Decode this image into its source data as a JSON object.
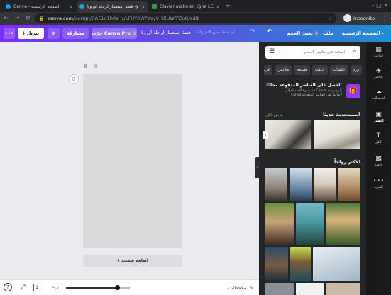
{
  "browser": {
    "tabs": [
      {
        "title": "Canva - الصفحة الرئيسية",
        "active": false
      },
      {
        "title": "قصة إستعمار لرحلة أوروبا -y",
        "active": true
      },
      {
        "title": "Clavier arabe en ligne LEXI",
        "active": false
      }
    ],
    "new_tab": "+",
    "url_host": "canva.com",
    "url_path": "/design/DAE1d1h0sHs/LFHYXWPeVy9_kllUWfPZoQ/edit",
    "profile": "Incognito"
  },
  "header": {
    "home": "الصفحة الرئيسية",
    "file": "ملف",
    "resize": "تغيير الحجم",
    "save_status": "تم حفظ جميع التغييرات",
    "title": "قصة إستعمار لرحلة أوروبا",
    "pro": "جرّب Canva Pro",
    "share": "مشاركة",
    "download": "تنزيل",
    "more": "•••"
  },
  "editor": {
    "add_page": "+ إضافة صفحة",
    "notes": "ملاحظات",
    "zoom": "٣٠٪",
    "zoom_value": 0.8,
    "page_number": "1"
  },
  "panel": {
    "search_placeholder": "البحث في ملايين الصور",
    "chips": [
      "ورد",
      "خلفيات",
      "خلفية",
      "طبيعة",
      "ملابس",
      "قرد"
    ],
    "promo_title": "احصل على العناصر المدفوعة مجانًا!",
    "promo_body": "قم بدعوة الأصدقاء إلى Canva واربح رصيد Canva لإنفاقها على العناصر المدفوعة",
    "recent_title": "المستخدمة حديثًا",
    "see_all": "عرض الكل",
    "popular_title": "الأكثر رواجاً"
  },
  "rail": [
    {
      "label": "قوالب",
      "icon": "templates-icon",
      "glyph": "▦"
    },
    {
      "label": "عناصر",
      "icon": "elements-icon",
      "glyph": "◈"
    },
    {
      "label": "التحميلات",
      "icon": "uploads-icon",
      "glyph": "☁"
    },
    {
      "label": "الصور",
      "icon": "photos-icon",
      "glyph": "▣",
      "active": true
    },
    {
      "label": "النص",
      "icon": "text-icon",
      "glyph": "T"
    },
    {
      "label": "خلفية",
      "icon": "background-icon",
      "glyph": "▩"
    },
    {
      "label": "المزيد",
      "icon": "more-icon",
      "glyph": "•••"
    }
  ],
  "colors": {
    "brand_purple": "#7b2ff7",
    "brand_blue": "#1f8fd3",
    "gift": "#8b3dff"
  }
}
